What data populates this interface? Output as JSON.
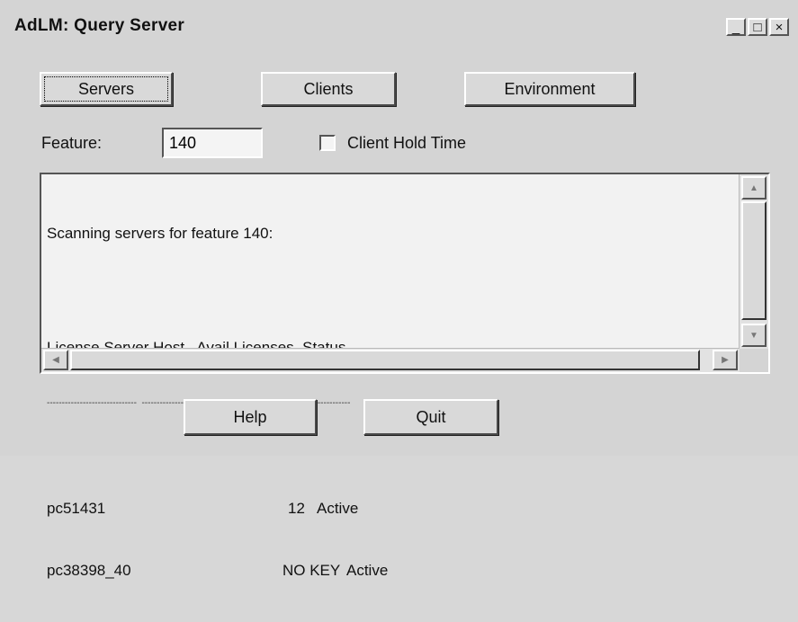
{
  "window": {
    "title": "AdLM: Query Server",
    "minimize_glyph": "_",
    "maximize_glyph": "□",
    "close_glyph": "×"
  },
  "tabs": {
    "servers": "Servers",
    "clients": "Clients",
    "environment": "Environment"
  },
  "feature": {
    "label": "Feature:",
    "value": "140"
  },
  "client_hold_time": {
    "label": "Client Hold Time",
    "checked": false
  },
  "output": {
    "heading": "Scanning servers for feature 140:",
    "columns": [
      "License Server Host",
      "Avail Licenses",
      "Status"
    ],
    "separator": "------------------------------  ----------------  ----------------------------------------------------",
    "rows": [
      {
        "host": "pc51431",
        "licenses": "12",
        "status": "Active"
      },
      {
        "host": "pc38398_40",
        "licenses": "NO KEY",
        "status": "Active"
      }
    ]
  },
  "footer": {
    "help": "Help",
    "quit": "Quit"
  }
}
